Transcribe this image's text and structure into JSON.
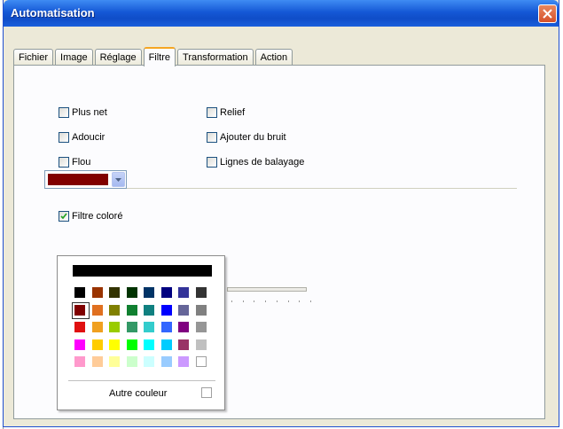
{
  "window": {
    "title": "Automatisation"
  },
  "tabs": [
    {
      "label": "Fichier",
      "active": false
    },
    {
      "label": "Image",
      "active": false
    },
    {
      "label": "Réglage",
      "active": false
    },
    {
      "label": "Filtre",
      "active": true
    },
    {
      "label": "Transformation",
      "active": false
    },
    {
      "label": "Action",
      "active": false
    }
  ],
  "filters": {
    "plus_net": {
      "label": "Plus net",
      "checked": false
    },
    "adoucir": {
      "label": "Adoucir",
      "checked": false
    },
    "flou": {
      "label": "Flou",
      "checked": false
    },
    "relief": {
      "label": "Relief",
      "checked": false
    },
    "bruit": {
      "label": "Ajouter du bruit",
      "checked": false
    },
    "balayage": {
      "label": "Lignes de balayage",
      "checked": false
    }
  },
  "color_filter": {
    "label": "Filtre coloré",
    "checked": true,
    "selected_color": "#800000"
  },
  "color_picker": {
    "top_color": "#000000",
    "palette": [
      "#000000",
      "#993300",
      "#333300",
      "#003300",
      "#003366",
      "#000080",
      "#333399",
      "#333333",
      "#800000",
      "#e07020",
      "#808000",
      "#108030",
      "#108080",
      "#0000ff",
      "#666699",
      "#808080",
      "#e01010",
      "#f0a020",
      "#99cc00",
      "#339966",
      "#33cccc",
      "#3366ff",
      "#800080",
      "#969696",
      "#ff00ff",
      "#ffcc00",
      "#ffff00",
      "#00ff00",
      "#00ffff",
      "#00ccff",
      "#993366",
      "#c0c0c0",
      "#ff99cc",
      "#ffcc99",
      "#ffff99",
      "#ccffcc",
      "#ccffff",
      "#99ccff",
      "#cc99ff",
      "#ffffff"
    ],
    "selected_index": 8,
    "other_label": "Autre couleur"
  },
  "icons": {
    "close": "close-x-icon",
    "checkmark": "checkmark-icon",
    "dropdown": "chevron-down-icon"
  },
  "colors": {
    "titlebar": "#0f4dc8",
    "active_tab_accent": "#f5a623",
    "close": "#d6512a"
  }
}
